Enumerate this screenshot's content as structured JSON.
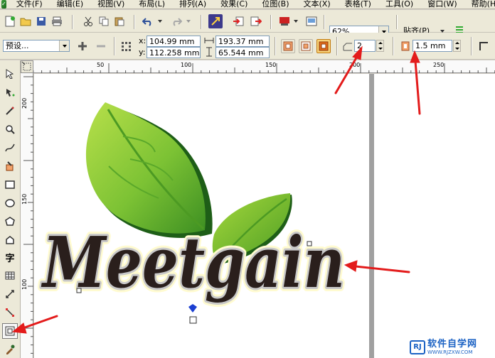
{
  "menu": {
    "items": [
      "文件(F)",
      "编辑(E)",
      "视图(V)",
      "布局(L)",
      "排列(A)",
      "效果(C)",
      "位图(B)",
      "文本(X)",
      "表格(T)",
      "工具(O)",
      "窗口(W)",
      "帮助(H)"
    ]
  },
  "toolbar": {
    "zoom_value": "62%",
    "snap_label": "贴齐(P)"
  },
  "properties": {
    "preset_value": "预设...",
    "x_label": "x:",
    "x_value": "104.99 mm",
    "y_label": "y:",
    "y_value": "112.258 mm",
    "width_value": "193.37 mm",
    "height_value": "65.544 mm",
    "steps_value": "2",
    "offset_value": "1.5 mm"
  },
  "ruler": {
    "h_ticks": [
      "50",
      "100",
      "150",
      "200",
      "250"
    ],
    "v_ticks": [
      "200",
      "150",
      "100"
    ]
  },
  "canvas": {
    "logo_text": "Meetgain"
  },
  "tools": {
    "text_tool_glyph": "字"
  },
  "watermark": {
    "brand": "软件自学网",
    "url": "WWW.RJZXW.COM",
    "logo": "RJ"
  },
  "colors": {
    "leaf_light": "#8ccf2c",
    "leaf_dark": "#1f6b1a",
    "text_dark": "#2a1f1c",
    "contour_glow": "#fffbd0",
    "arrow_red": "#e31b1b",
    "watermark_blue": "#1b62c4"
  }
}
